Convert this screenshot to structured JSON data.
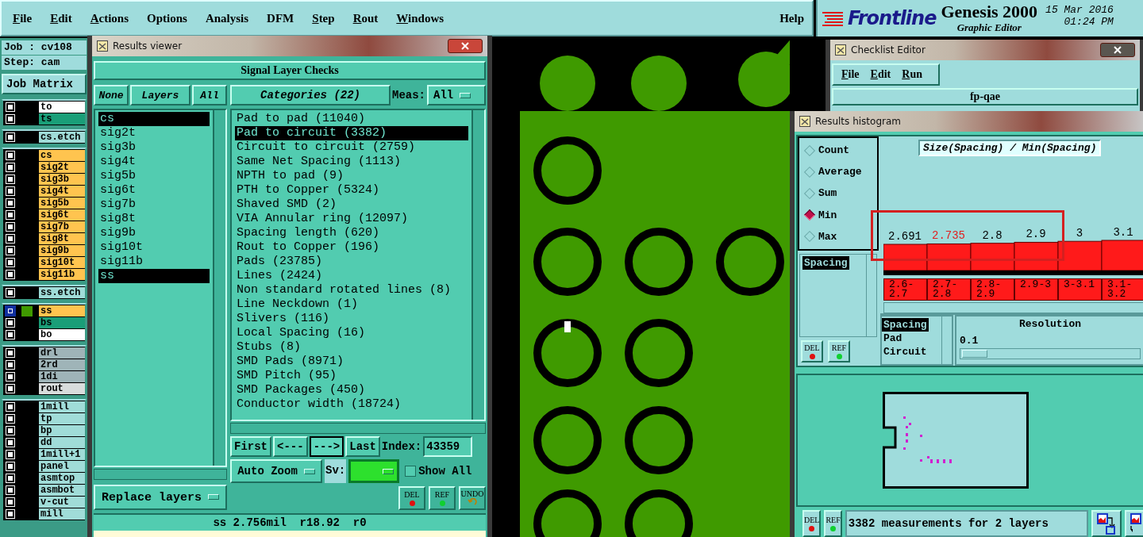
{
  "menu_bar": {
    "menus": [
      {
        "label": "File",
        "mnemonic": true
      },
      {
        "label": "Edit",
        "mnemonic": true
      },
      {
        "label": "Actions",
        "mnemonic": true
      },
      {
        "label": "Options",
        "mnemonic": false
      },
      {
        "label": "Analysis",
        "mnemonic": false
      },
      {
        "label": "DFM",
        "mnemonic": false
      },
      {
        "label": "Step",
        "mnemonic": true
      },
      {
        "label": "Rout",
        "mnemonic": true
      },
      {
        "label": "Windows",
        "mnemonic": true
      }
    ],
    "help": "Help"
  },
  "brand": {
    "logo": "Frontline",
    "product": "Genesis 2000",
    "subtitle": "Graphic Editor",
    "date": "15 Mar 2016",
    "time": "01:24 PM"
  },
  "job_panel": {
    "job": "Job : cv108",
    "step": "Step: cam",
    "matrix_button": "Job Matrix",
    "layer_groups": [
      {
        "layers": [
          {
            "name": "to",
            "color": "#ffffff",
            "selected": false
          },
          {
            "name": "ts",
            "color": "#1a9e78",
            "selected": false
          }
        ]
      },
      {
        "layers": [
          {
            "name": "cs.etch",
            "color": "#a0dcd8",
            "selected": false
          }
        ]
      },
      {
        "layers": [
          {
            "name": "cs",
            "color": "#ffc44f",
            "selected": false
          },
          {
            "name": "sig2t",
            "color": "#ffc44f",
            "selected": false
          },
          {
            "name": "sig3b",
            "color": "#ffc44f",
            "selected": false
          },
          {
            "name": "sig4t",
            "color": "#ffc44f",
            "selected": false
          },
          {
            "name": "sig5b",
            "color": "#ffc44f",
            "selected": false
          },
          {
            "name": "sig6t",
            "color": "#ffc44f",
            "selected": false
          },
          {
            "name": "sig7b",
            "color": "#ffc44f",
            "selected": false
          },
          {
            "name": "sig8t",
            "color": "#ffc44f",
            "selected": false
          },
          {
            "name": "sig9b",
            "color": "#ffc44f",
            "selected": false
          },
          {
            "name": "sig10t",
            "color": "#ffc44f",
            "selected": false
          },
          {
            "name": "sig11b",
            "color": "#ffc44f",
            "selected": false
          }
        ]
      },
      {
        "layers": [
          {
            "name": "ss.etch",
            "color": "#a0dcd8",
            "selected": false
          }
        ]
      },
      {
        "layers": [
          {
            "name": "ss",
            "color": "#ffc44f",
            "selected": true
          },
          {
            "name": "bs",
            "color": "#1a9e78",
            "selected": false
          },
          {
            "name": "bo",
            "color": "#ffffff",
            "selected": false
          }
        ]
      },
      {
        "layers": [
          {
            "name": "drl",
            "color": "#9fb4b8",
            "selected": false
          },
          {
            "name": "2rd",
            "color": "#9fb4b8",
            "selected": false
          },
          {
            "name": "1di",
            "color": "#9fb4b8",
            "selected": false
          },
          {
            "name": "rout",
            "color": "#d8dcdc",
            "selected": false
          }
        ]
      },
      {
        "layers": [
          {
            "name": "1mill",
            "color": "#a0dcd8",
            "selected": false
          },
          {
            "name": "tp",
            "color": "#a0dcd8",
            "selected": false
          },
          {
            "name": "bp",
            "color": "#a0dcd8",
            "selected": false
          },
          {
            "name": "dd",
            "color": "#a0dcd8",
            "selected": false
          },
          {
            "name": "1mill+1",
            "color": "#a0dcd8",
            "selected": false
          },
          {
            "name": "panel",
            "color": "#a0dcd8",
            "selected": false
          },
          {
            "name": "asmtop",
            "color": "#a0dcd8",
            "selected": false
          },
          {
            "name": "asmbot",
            "color": "#a0dcd8",
            "selected": false
          },
          {
            "name": "v-cut",
            "color": "#a0dcd8",
            "selected": false
          },
          {
            "name": "mill",
            "color": "#a0dcd8",
            "selected": false
          }
        ]
      }
    ]
  },
  "results_viewer": {
    "title": "Results viewer",
    "header": "Signal Layer Checks",
    "layer_buttons": [
      "None",
      "Layers",
      "All"
    ],
    "layers": [
      {
        "name": "cs",
        "selected": true
      },
      {
        "name": "sig2t",
        "selected": false
      },
      {
        "name": "sig3b",
        "selected": false
      },
      {
        "name": "sig4t",
        "selected": false
      },
      {
        "name": "sig5b",
        "selected": false
      },
      {
        "name": "sig6t",
        "selected": false
      },
      {
        "name": "sig7b",
        "selected": false
      },
      {
        "name": "sig8t",
        "selected": false
      },
      {
        "name": "sig9b",
        "selected": false
      },
      {
        "name": "sig10t",
        "selected": false
      },
      {
        "name": "sig11b",
        "selected": false
      },
      {
        "name": "ss",
        "selected": true
      }
    ],
    "categories_button": "Categories (22)",
    "meas_label": "Meas:",
    "meas_value": "All",
    "categories": [
      {
        "label": "Pad to pad (11040)",
        "selected": false
      },
      {
        "label": "Pad to circuit (3382)",
        "selected": true
      },
      {
        "label": "Circuit to circuit (2759)",
        "selected": false
      },
      {
        "label": "Same Net Spacing (1113)",
        "selected": false
      },
      {
        "label": "NPTH to pad (9)",
        "selected": false
      },
      {
        "label": "PTH to Copper (5324)",
        "selected": false
      },
      {
        "label": "Shaved SMD (2)",
        "selected": false
      },
      {
        "label": "VIA Annular ring (12097)",
        "selected": false
      },
      {
        "label": "Spacing length (620)",
        "selected": false
      },
      {
        "label": "Rout to Copper (196)",
        "selected": false
      },
      {
        "label": "Pads (23785)",
        "selected": false
      },
      {
        "label": "Lines (2424)",
        "selected": false
      },
      {
        "label": "Non standard rotated lines (8)",
        "selected": false
      },
      {
        "label": "Line Neckdown (1)",
        "selected": false
      },
      {
        "label": "Slivers (116)",
        "selected": false
      },
      {
        "label": "Local Spacing (16)",
        "selected": false
      },
      {
        "label": "Stubs (8)",
        "selected": false
      },
      {
        "label": "SMD Pads (8971)",
        "selected": false
      },
      {
        "label": "SMD Pitch (95)",
        "selected": false
      },
      {
        "label": "SMD Packages (450)",
        "selected": false
      },
      {
        "label": "Conductor width (18724)",
        "selected": false
      }
    ],
    "nav_buttons": [
      {
        "label": "First",
        "selected": false
      },
      {
        "label": "<---",
        "selected": false
      },
      {
        "label": "--->",
        "selected": true
      },
      {
        "label": "Last",
        "selected": false
      }
    ],
    "index_label": "Index:",
    "index_value": "43359",
    "auto_zoom": "Auto Zoom",
    "sv_label": "Sv:",
    "show_all": {
      "label": "Show All",
      "checked": false
    },
    "replace_layers": "Replace layers",
    "action_buttons": [
      {
        "label": "DEL",
        "kind": "del"
      },
      {
        "label": "REF",
        "kind": "ref"
      },
      {
        "label": "UNDO",
        "kind": "undo"
      }
    ],
    "status": "ss 2.756mil  r18.92  r0"
  },
  "checklist_editor": {
    "title": "Checklist Editor",
    "menus": [
      {
        "label": "File",
        "mnemonic": true
      },
      {
        "label": "Edit",
        "mnemonic": true
      },
      {
        "label": "Run",
        "mnemonic": true
      }
    ],
    "checklist": "fp-qae"
  },
  "results_histogram": {
    "title": "Results histogram",
    "modes": [
      {
        "label": "Count",
        "selected": false
      },
      {
        "label": "Average",
        "selected": false
      },
      {
        "label": "Sum",
        "selected": false
      },
      {
        "label": "Min",
        "selected": true
      },
      {
        "label": "Max",
        "selected": false
      }
    ],
    "measure_list": [
      {
        "label": "Spacing",
        "selected": true
      }
    ],
    "list_buttons": [
      {
        "label": "DEL",
        "kind": "del"
      },
      {
        "label": "REF",
        "kind": "ref"
      }
    ],
    "chart_data": {
      "type": "bar",
      "title": "Size(Spacing) / Min(Spacing)",
      "categories": [
        "2.6-2.7",
        "2.7-2.8",
        "2.8-2.9",
        "2.9-3",
        "3-3.1",
        "3.1-3.2"
      ],
      "values": [
        2.691,
        2.735,
        2.8,
        2.9,
        3,
        3.1
      ],
      "data_labels": true
    },
    "bins": [
      {
        "selected": false
      },
      {
        "selected": true
      },
      {
        "selected": false
      },
      {
        "selected": false
      },
      {
        "selected": false
      },
      {
        "selected": false
      }
    ],
    "type_list": [
      {
        "label": "Spacing",
        "selected": true
      },
      {
        "label": "Pad",
        "selected": false
      },
      {
        "label": "Circuit",
        "selected": false
      }
    ],
    "resolution_label": "Resolution",
    "resolution_value": "0.1",
    "resolution_slider": {
      "level": 0
    },
    "footer_buttons": [
      {
        "label": "DEL",
        "kind": "del"
      },
      {
        "label": "REF",
        "kind": "ref"
      }
    ],
    "status": "3382 measurements for 2 layers"
  }
}
